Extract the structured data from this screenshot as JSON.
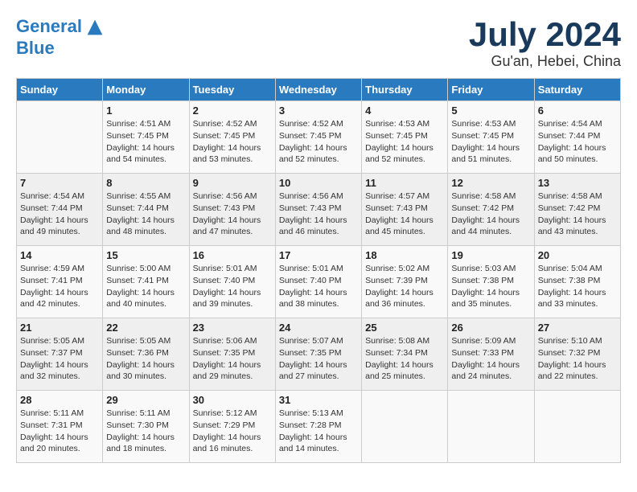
{
  "header": {
    "logo_line1": "General",
    "logo_line2": "Blue",
    "month": "July 2024",
    "location": "Gu'an, Hebei, China"
  },
  "weekdays": [
    "Sunday",
    "Monday",
    "Tuesday",
    "Wednesday",
    "Thursday",
    "Friday",
    "Saturday"
  ],
  "weeks": [
    [
      {
        "day": "",
        "info": ""
      },
      {
        "day": "1",
        "info": "Sunrise: 4:51 AM\nSunset: 7:45 PM\nDaylight: 14 hours\nand 54 minutes."
      },
      {
        "day": "2",
        "info": "Sunrise: 4:52 AM\nSunset: 7:45 PM\nDaylight: 14 hours\nand 53 minutes."
      },
      {
        "day": "3",
        "info": "Sunrise: 4:52 AM\nSunset: 7:45 PM\nDaylight: 14 hours\nand 52 minutes."
      },
      {
        "day": "4",
        "info": "Sunrise: 4:53 AM\nSunset: 7:45 PM\nDaylight: 14 hours\nand 52 minutes."
      },
      {
        "day": "5",
        "info": "Sunrise: 4:53 AM\nSunset: 7:45 PM\nDaylight: 14 hours\nand 51 minutes."
      },
      {
        "day": "6",
        "info": "Sunrise: 4:54 AM\nSunset: 7:44 PM\nDaylight: 14 hours\nand 50 minutes."
      }
    ],
    [
      {
        "day": "7",
        "info": "Sunrise: 4:54 AM\nSunset: 7:44 PM\nDaylight: 14 hours\nand 49 minutes."
      },
      {
        "day": "8",
        "info": "Sunrise: 4:55 AM\nSunset: 7:44 PM\nDaylight: 14 hours\nand 48 minutes."
      },
      {
        "day": "9",
        "info": "Sunrise: 4:56 AM\nSunset: 7:43 PM\nDaylight: 14 hours\nand 47 minutes."
      },
      {
        "day": "10",
        "info": "Sunrise: 4:56 AM\nSunset: 7:43 PM\nDaylight: 14 hours\nand 46 minutes."
      },
      {
        "day": "11",
        "info": "Sunrise: 4:57 AM\nSunset: 7:43 PM\nDaylight: 14 hours\nand 45 minutes."
      },
      {
        "day": "12",
        "info": "Sunrise: 4:58 AM\nSunset: 7:42 PM\nDaylight: 14 hours\nand 44 minutes."
      },
      {
        "day": "13",
        "info": "Sunrise: 4:58 AM\nSunset: 7:42 PM\nDaylight: 14 hours\nand 43 minutes."
      }
    ],
    [
      {
        "day": "14",
        "info": "Sunrise: 4:59 AM\nSunset: 7:41 PM\nDaylight: 14 hours\nand 42 minutes."
      },
      {
        "day": "15",
        "info": "Sunrise: 5:00 AM\nSunset: 7:41 PM\nDaylight: 14 hours\nand 40 minutes."
      },
      {
        "day": "16",
        "info": "Sunrise: 5:01 AM\nSunset: 7:40 PM\nDaylight: 14 hours\nand 39 minutes."
      },
      {
        "day": "17",
        "info": "Sunrise: 5:01 AM\nSunset: 7:40 PM\nDaylight: 14 hours\nand 38 minutes."
      },
      {
        "day": "18",
        "info": "Sunrise: 5:02 AM\nSunset: 7:39 PM\nDaylight: 14 hours\nand 36 minutes."
      },
      {
        "day": "19",
        "info": "Sunrise: 5:03 AM\nSunset: 7:38 PM\nDaylight: 14 hours\nand 35 minutes."
      },
      {
        "day": "20",
        "info": "Sunrise: 5:04 AM\nSunset: 7:38 PM\nDaylight: 14 hours\nand 33 minutes."
      }
    ],
    [
      {
        "day": "21",
        "info": "Sunrise: 5:05 AM\nSunset: 7:37 PM\nDaylight: 14 hours\nand 32 minutes."
      },
      {
        "day": "22",
        "info": "Sunrise: 5:05 AM\nSunset: 7:36 PM\nDaylight: 14 hours\nand 30 minutes."
      },
      {
        "day": "23",
        "info": "Sunrise: 5:06 AM\nSunset: 7:35 PM\nDaylight: 14 hours\nand 29 minutes."
      },
      {
        "day": "24",
        "info": "Sunrise: 5:07 AM\nSunset: 7:35 PM\nDaylight: 14 hours\nand 27 minutes."
      },
      {
        "day": "25",
        "info": "Sunrise: 5:08 AM\nSunset: 7:34 PM\nDaylight: 14 hours\nand 25 minutes."
      },
      {
        "day": "26",
        "info": "Sunrise: 5:09 AM\nSunset: 7:33 PM\nDaylight: 14 hours\nand 24 minutes."
      },
      {
        "day": "27",
        "info": "Sunrise: 5:10 AM\nSunset: 7:32 PM\nDaylight: 14 hours\nand 22 minutes."
      }
    ],
    [
      {
        "day": "28",
        "info": "Sunrise: 5:11 AM\nSunset: 7:31 PM\nDaylight: 14 hours\nand 20 minutes."
      },
      {
        "day": "29",
        "info": "Sunrise: 5:11 AM\nSunset: 7:30 PM\nDaylight: 14 hours\nand 18 minutes."
      },
      {
        "day": "30",
        "info": "Sunrise: 5:12 AM\nSunset: 7:29 PM\nDaylight: 14 hours\nand 16 minutes."
      },
      {
        "day": "31",
        "info": "Sunrise: 5:13 AM\nSunset: 7:28 PM\nDaylight: 14 hours\nand 14 minutes."
      },
      {
        "day": "",
        "info": ""
      },
      {
        "day": "",
        "info": ""
      },
      {
        "day": "",
        "info": ""
      }
    ]
  ]
}
